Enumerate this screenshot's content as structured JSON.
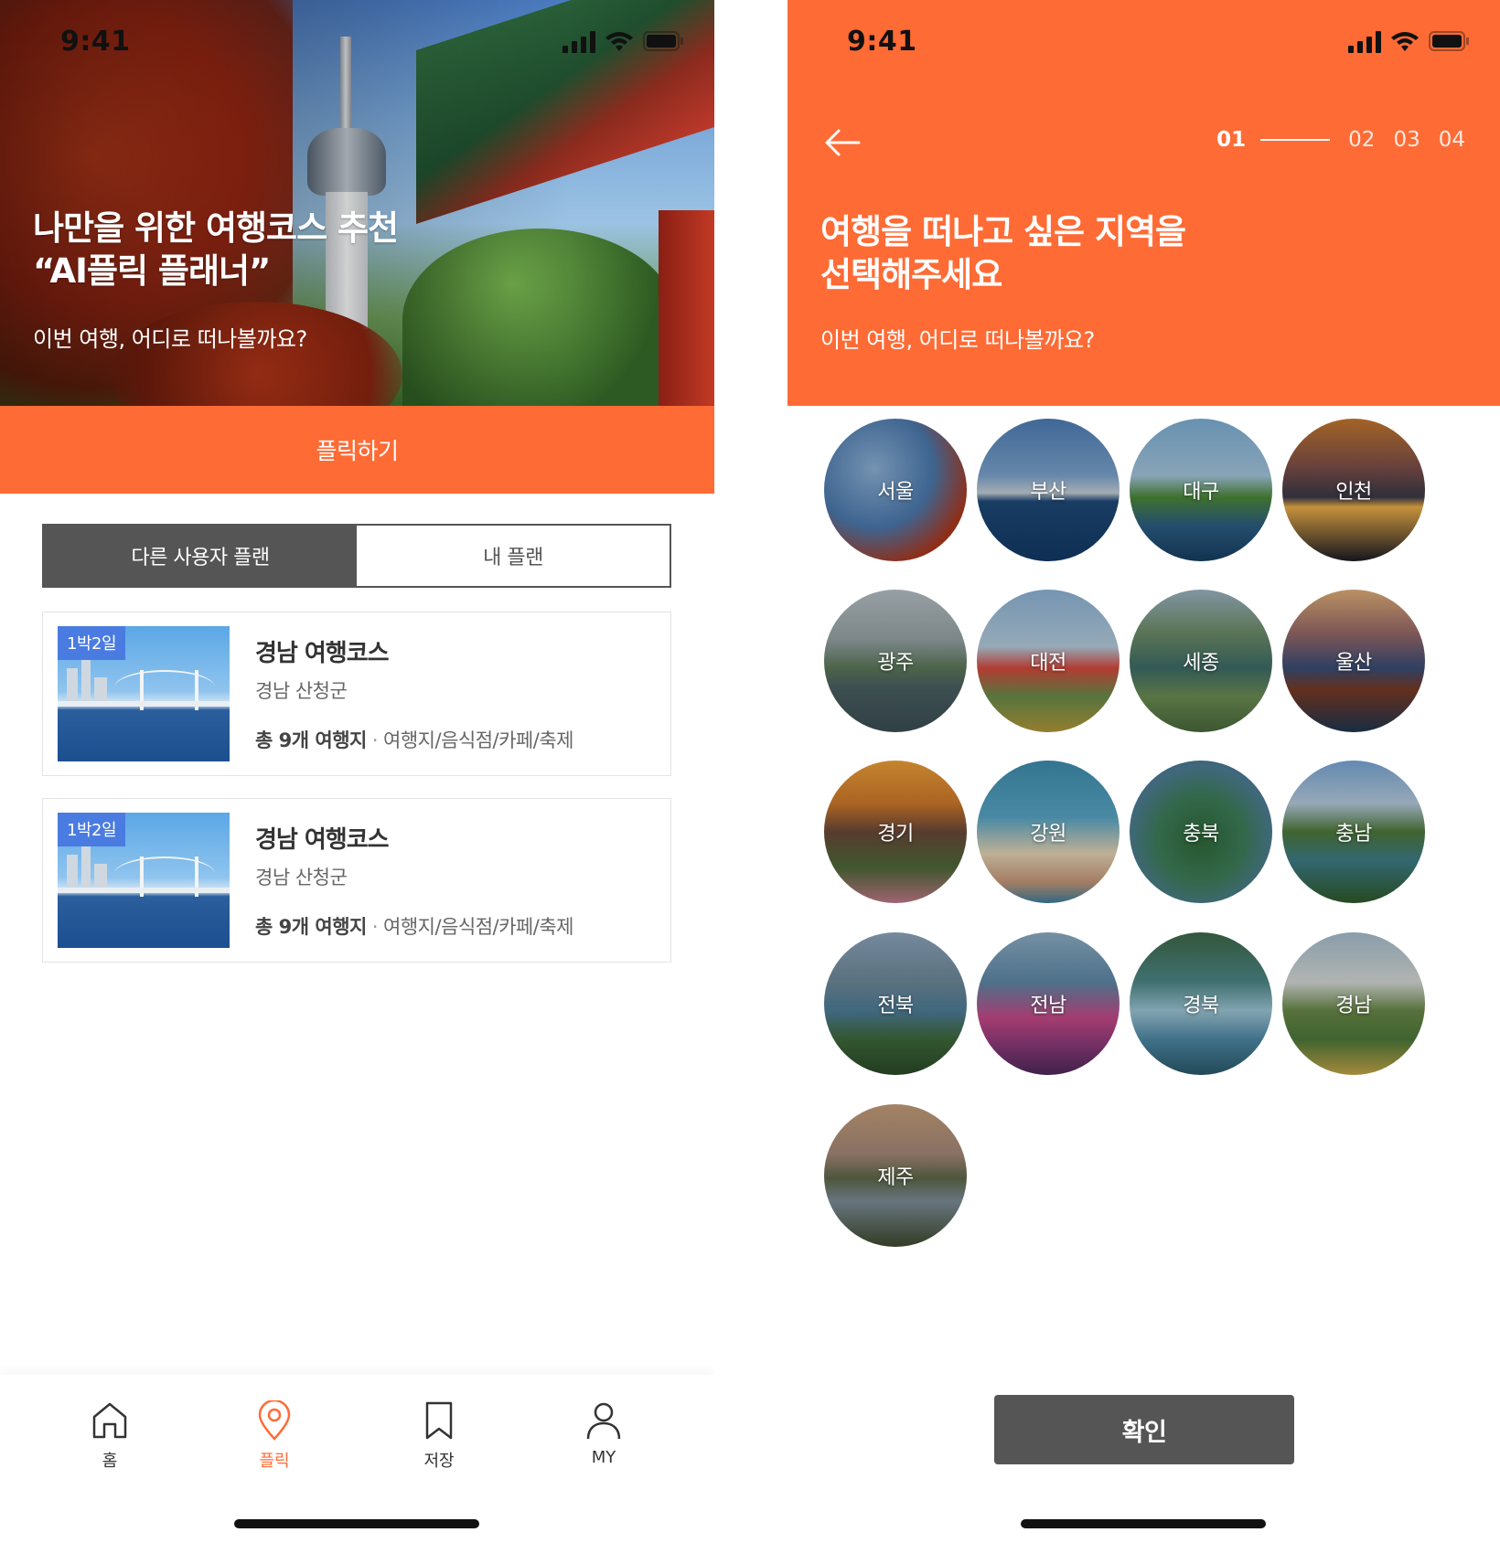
{
  "left": {
    "status": {
      "time": "9:41"
    },
    "hero": {
      "title_line1": "나만을 위한 여행코스 추천",
      "title_line2": "“AI플릭 플래너”",
      "subtitle": "이번 여행, 어디로 떠나볼까요?"
    },
    "plick_button": "플릭하기",
    "tabs": [
      {
        "label": "다른 사용자 플랜",
        "active": true
      },
      {
        "label": "내 플랜",
        "active": false
      }
    ],
    "cards": [
      {
        "badge": "1박2일",
        "title": "경남 여행코스",
        "location": "경남 산청군",
        "count": "총 9개 여행지",
        "dot": "·",
        "categories": "여행지/음식점/카페/축제"
      },
      {
        "badge": "1박2일",
        "title": "경남 여행코스",
        "location": "경남 산청군",
        "count": "총 9개 여행지",
        "dot": "·",
        "categories": "여행지/음식점/카페/축제"
      }
    ],
    "nav": [
      {
        "label": "홈",
        "icon": "home-icon",
        "active": false
      },
      {
        "label": "플릭",
        "icon": "location-pin-icon",
        "active": true
      },
      {
        "label": "저장",
        "icon": "bookmark-icon",
        "active": false
      },
      {
        "label": "MY",
        "icon": "user-icon",
        "active": false
      }
    ]
  },
  "right": {
    "status": {
      "time": "9:41"
    },
    "steps": {
      "current": "01",
      "others": [
        "02",
        "03",
        "04"
      ]
    },
    "title_line1": "여행을 떠나고 싶은 지역을",
    "title_line2": "선택해주세요",
    "subtitle": "이번 여행, 어디로 떠나볼까요?",
    "regions": [
      {
        "name": "서울"
      },
      {
        "name": "부산"
      },
      {
        "name": "대구"
      },
      {
        "name": "인천"
      },
      {
        "name": "광주"
      },
      {
        "name": "대전"
      },
      {
        "name": "세종"
      },
      {
        "name": "울산"
      },
      {
        "name": "경기"
      },
      {
        "name": "강원"
      },
      {
        "name": "충북"
      },
      {
        "name": "충남"
      },
      {
        "name": "전북"
      },
      {
        "name": "전남"
      },
      {
        "name": "경북"
      },
      {
        "name": "경남"
      },
      {
        "name": "제주"
      }
    ],
    "confirm_button": "확인"
  },
  "colors": {
    "accent": "#ff6b35",
    "dark_button": "#555555",
    "badge": "#4a7be0"
  }
}
